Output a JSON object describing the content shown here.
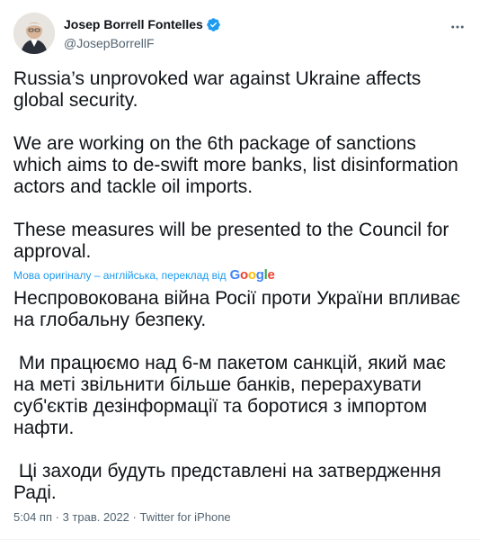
{
  "author": {
    "display_name": "Josep Borrell Fontelles",
    "handle": "@JosepBorrellF",
    "verified": true,
    "avatar_icon": "profile-photo"
  },
  "tweet": {
    "original_text": "Russia’s unprovoked war against Ukraine affects global security.\n\nWe are working on the 6th package of sanctions which aims to de-swift more banks, list disinformation actors and tackle oil imports.\n\nThese measures will be presented to the Council for approval.",
    "translation_note": "Мова оригіналу – англійська, переклад від",
    "translation_provider": "Google",
    "translated_text": "Неспровокована війна Росії проти України впливає на глобальну безпеку.\n\n Ми працюємо над 6-м пакетом санкцій, який має на меті звільнити більше банків, перерахувати суб'єктів дезінформації та боротися з імпортом нафти.\n\n Ці заходи будуть представлені на затвердження Раді."
  },
  "meta": {
    "time": "5:04 пп",
    "separator": "·",
    "date": "3 трав. 2022",
    "source": "Twitter for iPhone"
  },
  "colors": {
    "text": "#0f1419",
    "secondary": "#536471",
    "accent": "#1d9bf0"
  }
}
